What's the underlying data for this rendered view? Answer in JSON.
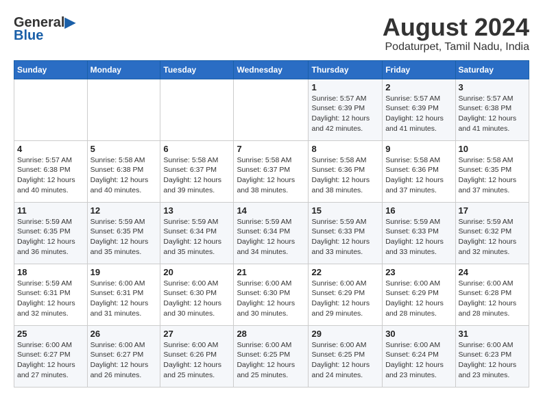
{
  "logo": {
    "line1": "General",
    "line2": "Blue"
  },
  "title": "August 2024",
  "subtitle": "Podaturpet, Tamil Nadu, India",
  "weekdays": [
    "Sunday",
    "Monday",
    "Tuesday",
    "Wednesday",
    "Thursday",
    "Friday",
    "Saturday"
  ],
  "weeks": [
    [
      {
        "day": "",
        "info": ""
      },
      {
        "day": "",
        "info": ""
      },
      {
        "day": "",
        "info": ""
      },
      {
        "day": "",
        "info": ""
      },
      {
        "day": "1",
        "info": "Sunrise: 5:57 AM\nSunset: 6:39 PM\nDaylight: 12 hours\nand 42 minutes."
      },
      {
        "day": "2",
        "info": "Sunrise: 5:57 AM\nSunset: 6:39 PM\nDaylight: 12 hours\nand 41 minutes."
      },
      {
        "day": "3",
        "info": "Sunrise: 5:57 AM\nSunset: 6:38 PM\nDaylight: 12 hours\nand 41 minutes."
      }
    ],
    [
      {
        "day": "4",
        "info": "Sunrise: 5:57 AM\nSunset: 6:38 PM\nDaylight: 12 hours\nand 40 minutes."
      },
      {
        "day": "5",
        "info": "Sunrise: 5:58 AM\nSunset: 6:38 PM\nDaylight: 12 hours\nand 40 minutes."
      },
      {
        "day": "6",
        "info": "Sunrise: 5:58 AM\nSunset: 6:37 PM\nDaylight: 12 hours\nand 39 minutes."
      },
      {
        "day": "7",
        "info": "Sunrise: 5:58 AM\nSunset: 6:37 PM\nDaylight: 12 hours\nand 38 minutes."
      },
      {
        "day": "8",
        "info": "Sunrise: 5:58 AM\nSunset: 6:36 PM\nDaylight: 12 hours\nand 38 minutes."
      },
      {
        "day": "9",
        "info": "Sunrise: 5:58 AM\nSunset: 6:36 PM\nDaylight: 12 hours\nand 37 minutes."
      },
      {
        "day": "10",
        "info": "Sunrise: 5:58 AM\nSunset: 6:35 PM\nDaylight: 12 hours\nand 37 minutes."
      }
    ],
    [
      {
        "day": "11",
        "info": "Sunrise: 5:59 AM\nSunset: 6:35 PM\nDaylight: 12 hours\nand 36 minutes."
      },
      {
        "day": "12",
        "info": "Sunrise: 5:59 AM\nSunset: 6:35 PM\nDaylight: 12 hours\nand 35 minutes."
      },
      {
        "day": "13",
        "info": "Sunrise: 5:59 AM\nSunset: 6:34 PM\nDaylight: 12 hours\nand 35 minutes."
      },
      {
        "day": "14",
        "info": "Sunrise: 5:59 AM\nSunset: 6:34 PM\nDaylight: 12 hours\nand 34 minutes."
      },
      {
        "day": "15",
        "info": "Sunrise: 5:59 AM\nSunset: 6:33 PM\nDaylight: 12 hours\nand 33 minutes."
      },
      {
        "day": "16",
        "info": "Sunrise: 5:59 AM\nSunset: 6:33 PM\nDaylight: 12 hours\nand 33 minutes."
      },
      {
        "day": "17",
        "info": "Sunrise: 5:59 AM\nSunset: 6:32 PM\nDaylight: 12 hours\nand 32 minutes."
      }
    ],
    [
      {
        "day": "18",
        "info": "Sunrise: 5:59 AM\nSunset: 6:31 PM\nDaylight: 12 hours\nand 32 minutes."
      },
      {
        "day": "19",
        "info": "Sunrise: 6:00 AM\nSunset: 6:31 PM\nDaylight: 12 hours\nand 31 minutes."
      },
      {
        "day": "20",
        "info": "Sunrise: 6:00 AM\nSunset: 6:30 PM\nDaylight: 12 hours\nand 30 minutes."
      },
      {
        "day": "21",
        "info": "Sunrise: 6:00 AM\nSunset: 6:30 PM\nDaylight: 12 hours\nand 30 minutes."
      },
      {
        "day": "22",
        "info": "Sunrise: 6:00 AM\nSunset: 6:29 PM\nDaylight: 12 hours\nand 29 minutes."
      },
      {
        "day": "23",
        "info": "Sunrise: 6:00 AM\nSunset: 6:29 PM\nDaylight: 12 hours\nand 28 minutes."
      },
      {
        "day": "24",
        "info": "Sunrise: 6:00 AM\nSunset: 6:28 PM\nDaylight: 12 hours\nand 28 minutes."
      }
    ],
    [
      {
        "day": "25",
        "info": "Sunrise: 6:00 AM\nSunset: 6:27 PM\nDaylight: 12 hours\nand 27 minutes."
      },
      {
        "day": "26",
        "info": "Sunrise: 6:00 AM\nSunset: 6:27 PM\nDaylight: 12 hours\nand 26 minutes."
      },
      {
        "day": "27",
        "info": "Sunrise: 6:00 AM\nSunset: 6:26 PM\nDaylight: 12 hours\nand 25 minutes."
      },
      {
        "day": "28",
        "info": "Sunrise: 6:00 AM\nSunset: 6:25 PM\nDaylight: 12 hours\nand 25 minutes."
      },
      {
        "day": "29",
        "info": "Sunrise: 6:00 AM\nSunset: 6:25 PM\nDaylight: 12 hours\nand 24 minutes."
      },
      {
        "day": "30",
        "info": "Sunrise: 6:00 AM\nSunset: 6:24 PM\nDaylight: 12 hours\nand 23 minutes."
      },
      {
        "day": "31",
        "info": "Sunrise: 6:00 AM\nSunset: 6:23 PM\nDaylight: 12 hours\nand 23 minutes."
      }
    ]
  ]
}
